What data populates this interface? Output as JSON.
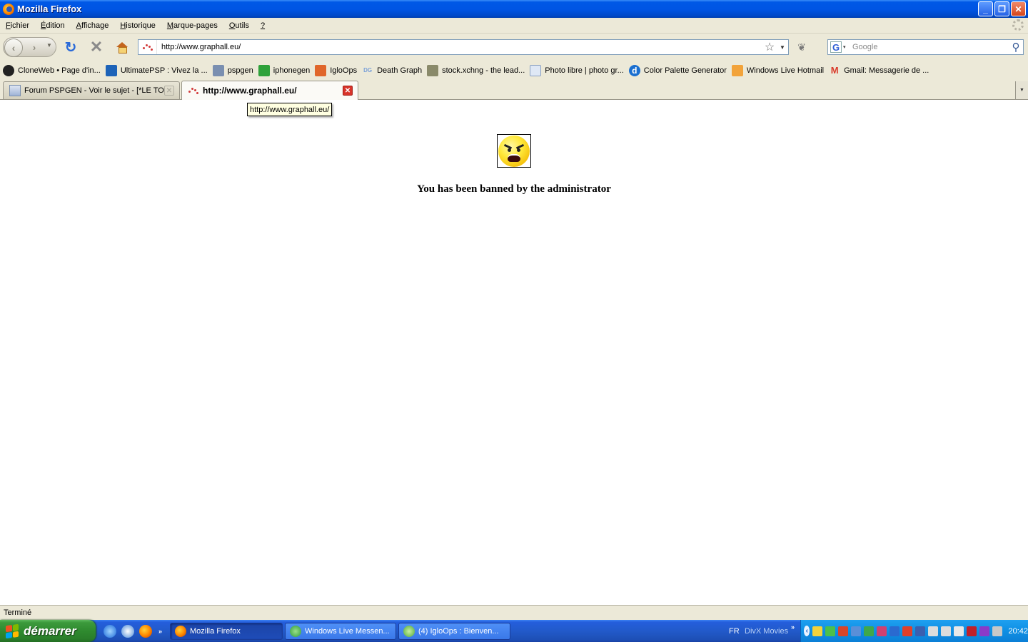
{
  "window": {
    "title": "Mozilla Firefox",
    "buttons": {
      "minimize": "_",
      "restore": "❐",
      "close": "✕"
    }
  },
  "menu": {
    "items": [
      {
        "label": "Fichier",
        "access": "F",
        "rest": "ichier"
      },
      {
        "label": "Édition",
        "access": "É",
        "rest": "dition"
      },
      {
        "label": "Affichage",
        "access": "A",
        "rest": "ffichage"
      },
      {
        "label": "Historique",
        "access": "H",
        "rest": "istorique"
      },
      {
        "label": "Marque-pages",
        "access": "M",
        "rest": "arque-pages"
      },
      {
        "label": "Outils",
        "access": "O",
        "rest": "utils"
      },
      {
        "label": "?",
        "access": "?",
        "rest": ""
      }
    ]
  },
  "navigation": {
    "back_glyph": "‹",
    "forward_glyph": "›",
    "dropdown_glyph": "▼",
    "reload_glyph": "↻",
    "stop_glyph": "✕",
    "url": "http://www.graphall.eu/",
    "star_glyph": "☆",
    "url_dropdown_glyph": "▼",
    "addon_glyph": "❦",
    "search": {
      "engine_letter": "G",
      "engine_dropdown": "▾",
      "placeholder": "Google",
      "go_glyph": "⚲"
    }
  },
  "bookmarks": [
    {
      "label": "CloneWeb • Page d'in...",
      "icon": "globe-dark-icon",
      "color": "#222222"
    },
    {
      "label": "UltimatePSP : Vivez la ...",
      "icon": "psp-icon",
      "color": "#1d63b8"
    },
    {
      "label": "pspgen",
      "icon": "page-icon",
      "color": "#7a8fb0"
    },
    {
      "label": "iphonegen",
      "icon": "phone-icon",
      "color": "#2fa23a"
    },
    {
      "label": "IgloOps",
      "icon": "igloops-icon",
      "color": "#e0662a"
    },
    {
      "label": "Death Graph",
      "icon": "deathgraph-icon",
      "color": "#7aa0d8",
      "glyph": "DG"
    },
    {
      "label": "stock.xchng - the lead...",
      "icon": "camera-icon",
      "color": "#8a8a6a"
    },
    {
      "label": "Photo libre | photo gr...",
      "icon": "blank-page-icon",
      "color": "#dfe8f5"
    },
    {
      "label": "Color Palette Generator",
      "icon": "colorpalette-icon",
      "color": "#1a6fd0",
      "glyph": "d"
    },
    {
      "label": "Windows Live Hotmail",
      "icon": "windows-flag-icon",
      "color": "#f2a33a"
    },
    {
      "label": "Gmail: Messagerie de ...",
      "icon": "gmail-icon",
      "color": "#d93a2a",
      "glyph": "M"
    }
  ],
  "tabs": [
    {
      "label": "Forum PSPGEN - Voir le sujet - [*LE TO...",
      "active": false,
      "close": "✕"
    },
    {
      "label": "http://www.graphall.eu/",
      "active": true,
      "close": "✕"
    }
  ],
  "tab_list_glyph": "▼",
  "tooltip": "http://www.graphall.eu/",
  "content": {
    "message": "You has been banned by the administrator"
  },
  "status": "Terminé",
  "taskbar": {
    "start_label": "démarrer",
    "quicklaunch_more": "»",
    "tasks": [
      {
        "label": "Mozilla Firefox",
        "icon_color": "#ff8a00"
      },
      {
        "label": "Windows Live Messen...",
        "icon_color": "#35b34a"
      },
      {
        "label": "(4) IgloOps : Bienven...",
        "icon_color": "#6cc04a"
      }
    ],
    "language": "FR",
    "divx_label": "DivX Movies",
    "divx_more": "»",
    "tray_collapse": "‹",
    "tray_colors": [
      "#f4d23a",
      "#4cc04a",
      "#d8452a",
      "#5a8fd8",
      "#3fa84a",
      "#d04070",
      "#2a6ad0",
      "#e0402a",
      "#3a5fb0",
      "#dcdcdc",
      "#dcdcdc",
      "#e8e8e8",
      "#c0202a",
      "#8a3ac8",
      "#c8c8c8"
    ],
    "clock": "20:42"
  }
}
